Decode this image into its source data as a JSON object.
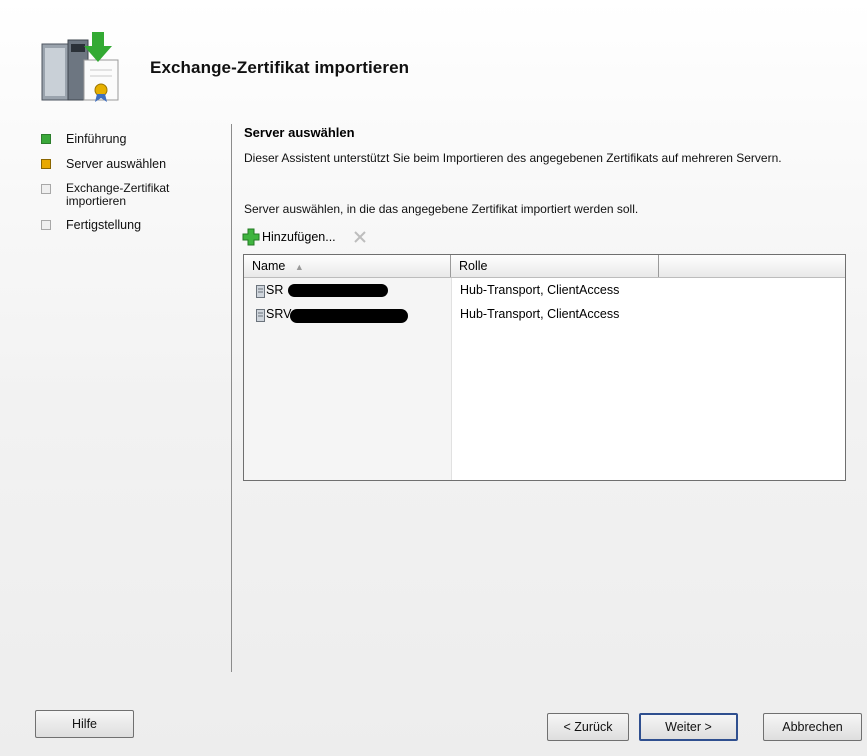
{
  "wizard": {
    "title": "Exchange-Zertifikat importieren",
    "steps": [
      {
        "label": "Einführung",
        "state": "complete"
      },
      {
        "label": "Server auswählen",
        "state": "current"
      },
      {
        "label": "Exchange-Zertifikat importieren",
        "state": "pending"
      },
      {
        "label": "Fertigstellung",
        "state": "pending"
      }
    ]
  },
  "page": {
    "heading": "Server auswählen",
    "description": "Dieser Assistent unterstützt Sie beim Importieren des angegebenen Zertifikats auf mehreren Servern.",
    "instruction": "Server auswählen, in die das angegebene Zertifikat importiert werden soll."
  },
  "toolbar": {
    "add_label": "Hinzufügen...",
    "add_icon": "green-plus-icon",
    "remove_icon": "red-x-icon"
  },
  "server_list": {
    "columns": [
      "Name",
      "Rolle"
    ],
    "sort_indicator": "▲",
    "rows": [
      {
        "name": "SR",
        "role": "Hub-Transport, ClientAccess"
      },
      {
        "name": "SRV",
        "role": "Hub-Transport, ClientAccess"
      }
    ]
  },
  "buttons": {
    "help": "Hilfe",
    "back": "< Zurück",
    "next": "Weiter >",
    "cancel": "Abbrechen"
  },
  "colors": {
    "step_complete": "#3aa83a",
    "step_current": "#e8a800",
    "step_pending": "#efefef",
    "default_button_border": "#2f4f8f"
  }
}
